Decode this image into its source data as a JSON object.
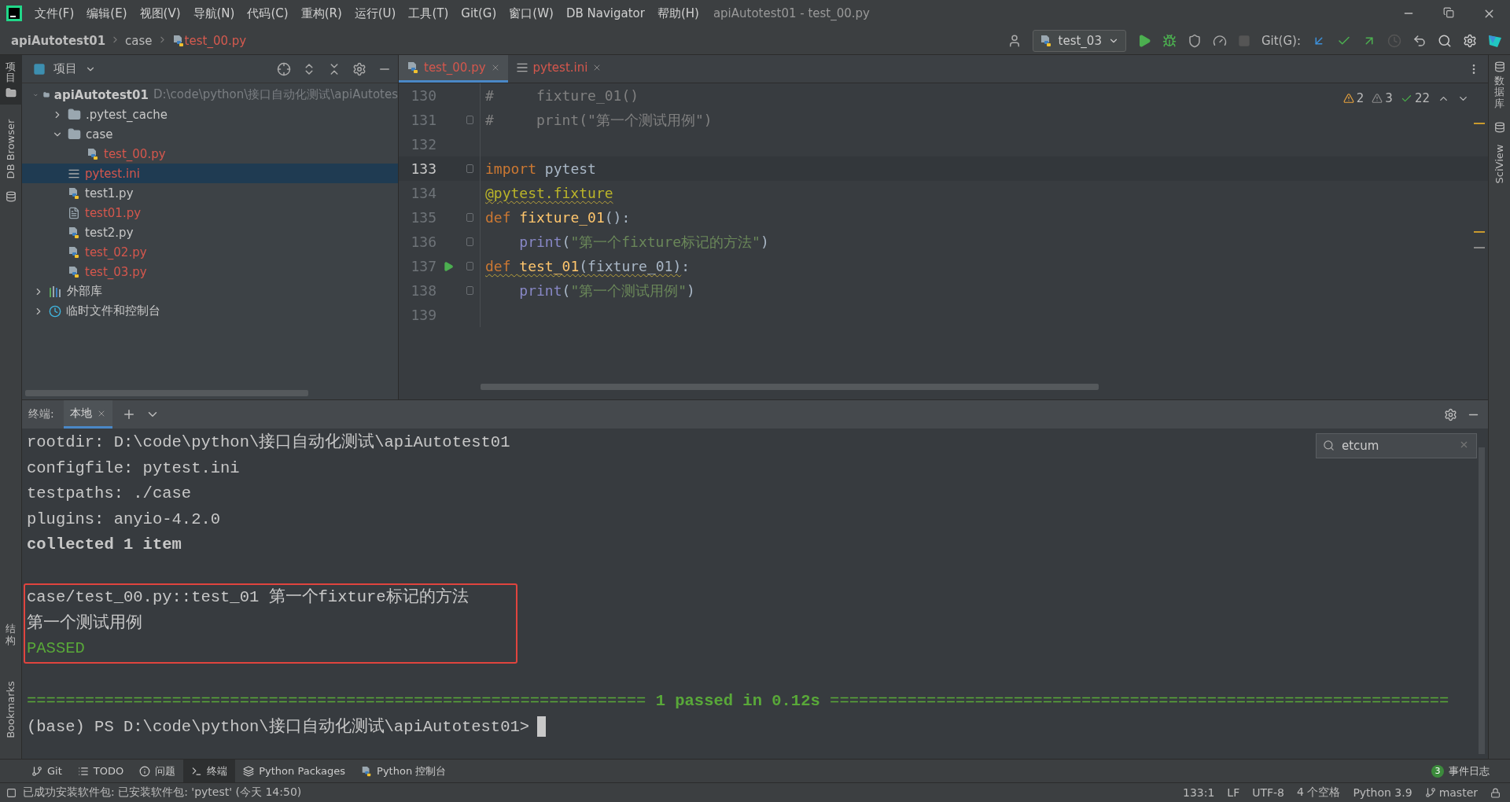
{
  "window_title": "apiAutotest01 - test_00.py",
  "menu": [
    "文件(F)",
    "编辑(E)",
    "视图(V)",
    "导航(N)",
    "代码(C)",
    "重构(R)",
    "运行(U)",
    "工具(T)",
    "Git(G)",
    "窗口(W)",
    "DB Navigator",
    "帮助(H)"
  ],
  "breadcrumb": [
    {
      "label": "apiAutotest01",
      "kind": "project"
    },
    {
      "label": "case",
      "kind": "folder"
    },
    {
      "label": "test_00.py",
      "kind": "file"
    }
  ],
  "toolbar": {
    "run_config": "test_03",
    "git_label": "Git(G):"
  },
  "left_stripe": [
    {
      "label": "项目",
      "kind": "cjk",
      "selected": true
    },
    {
      "label": "DB Browser",
      "kind": "latin",
      "selected": false
    }
  ],
  "left_stripe_bottom": [
    {
      "label": "结构",
      "kind": "cjk"
    },
    {
      "label": "Bookmarks",
      "kind": "latin"
    }
  ],
  "right_stripe": [
    {
      "label": "数据库",
      "kind": "cjk"
    },
    {
      "label": "SciView",
      "kind": "latin"
    }
  ],
  "project": {
    "title": "项目",
    "tree": [
      {
        "label": "apiAutotest01",
        "kind": "folder",
        "bold": true,
        "path": "D:\\code\\python\\接口自动化测试\\apiAutotes",
        "expanded": true,
        "selected": false,
        "untracked": false,
        "children": [
          {
            "label": ".pytest_cache",
            "kind": "folder",
            "expanded": false,
            "selected": false,
            "untracked": false
          },
          {
            "label": "case",
            "kind": "folder",
            "expanded": true,
            "selected": false,
            "untracked": false,
            "children": [
              {
                "label": "test_00.py",
                "kind": "python",
                "selected": false,
                "untracked": true
              }
            ]
          },
          {
            "label": "pytest.ini",
            "kind": "ini",
            "selected": true,
            "untracked": true
          },
          {
            "label": "test1.py",
            "kind": "python",
            "selected": false,
            "untracked": false
          },
          {
            "label": "test01.py",
            "kind": "text",
            "selected": false,
            "untracked": true
          },
          {
            "label": "test2.py",
            "kind": "python",
            "selected": false,
            "untracked": false
          },
          {
            "label": "test_02.py",
            "kind": "python",
            "selected": false,
            "untracked": true
          },
          {
            "label": "test_03.py",
            "kind": "python",
            "selected": false,
            "untracked": true
          }
        ]
      },
      {
        "label": "外部库",
        "kind": "library",
        "expanded": false,
        "selected": false,
        "untracked": false
      },
      {
        "label": "临时文件和控制台",
        "kind": "scratch",
        "expanded": false,
        "selected": false,
        "untracked": false
      }
    ]
  },
  "editor_tabs": [
    {
      "label": "test_00.py",
      "kind": "python",
      "selected": true
    },
    {
      "label": "pytest.ini",
      "kind": "ini",
      "selected": false
    }
  ],
  "inspections": [
    {
      "count": "2",
      "kind": "warning"
    },
    {
      "count": "3",
      "kind": "weak"
    },
    {
      "count": "22",
      "kind": "typo"
    }
  ],
  "code_lines": [
    {
      "number": "130",
      "current": false,
      "fold": false,
      "run": false,
      "tokens": [
        {
          "text": "#     fixture_01()",
          "kind": "comment"
        }
      ]
    },
    {
      "number": "131",
      "current": false,
      "fold": true,
      "run": false,
      "tokens": [
        {
          "text": "#     print(\"第一个测试用例\")",
          "kind": "comment"
        }
      ]
    },
    {
      "number": "132",
      "current": false,
      "fold": false,
      "run": false
    },
    {
      "number": "133",
      "current": true,
      "fold": true,
      "run": false,
      "tokens": [
        {
          "text": "import",
          "kind": "keyword"
        },
        {
          "text": " pytest",
          "kind": "plain"
        }
      ]
    },
    {
      "number": "134",
      "current": false,
      "fold": false,
      "run": false,
      "tokens": [
        {
          "text": "@pytest.fixture",
          "kind": "decorator",
          "warned": true
        }
      ]
    },
    {
      "number": "135",
      "current": false,
      "fold": true,
      "run": false,
      "tokens": [
        {
          "text": "def ",
          "kind": "keyword"
        },
        {
          "text": "fixture_01",
          "kind": "function"
        },
        {
          "text": "():",
          "kind": "plain"
        }
      ]
    },
    {
      "number": "136",
      "current": false,
      "fold": true,
      "run": false,
      "tokens": [
        {
          "text": "    print",
          "kind": "builtin"
        },
        {
          "text": "(",
          "kind": "plain"
        },
        {
          "text": "\"第一个fixture标记的方法\"",
          "kind": "string"
        },
        {
          "text": ")",
          "kind": "plain"
        }
      ]
    },
    {
      "number": "137",
      "current": false,
      "fold": true,
      "run": true,
      "tokens": [
        {
          "text": "def ",
          "kind": "keyword",
          "warned": true
        },
        {
          "text": "test_01",
          "kind": "function",
          "warned": true
        },
        {
          "text": "(fixture_01)",
          "kind": "plain",
          "warned": true
        },
        {
          "text": ":",
          "kind": "plain"
        }
      ]
    },
    {
      "number": "138",
      "current": false,
      "fold": true,
      "run": false,
      "tokens": [
        {
          "text": "    print",
          "kind": "builtin"
        },
        {
          "text": "(",
          "kind": "plain"
        },
        {
          "text": "\"第一个测试用例\"",
          "kind": "string"
        },
        {
          "text": ")",
          "kind": "plain"
        }
      ]
    },
    {
      "number": "139",
      "current": false,
      "fold": false,
      "run": false
    }
  ],
  "terminal": {
    "title": "终端:",
    "tabs": [
      {
        "label": "本地",
        "selected": true
      }
    ],
    "search": {
      "value": "etcum"
    },
    "lines": [
      {
        "text": "rootdir: D:\\code\\python\\接口自动化测试\\apiAutotest01",
        "kind": "normal",
        "highlighted": false
      },
      {
        "text": "configfile: pytest.ini",
        "kind": "normal",
        "highlighted": false
      },
      {
        "text": "testpaths: ./case",
        "kind": "normal",
        "highlighted": false
      },
      {
        "text": "plugins: anyio-4.2.0",
        "kind": "normal",
        "highlighted": false
      },
      {
        "text": "collected 1 item",
        "kind": "bold",
        "highlighted": false
      },
      {
        "kind": "blank"
      },
      {
        "text": "case/test_00.py::test_01 第一个fixture标记的方法",
        "kind": "normal",
        "highlighted": true
      },
      {
        "text": "第一个测试用例",
        "kind": "normal",
        "highlighted": true
      },
      {
        "text": "PASSED",
        "kind": "passed",
        "highlighted": true
      },
      {
        "kind": "blank"
      },
      {
        "text": "================================================================ **1 passed in 0.12s** ================================================================",
        "kind": "summary",
        "highlighted": false
      },
      {
        "text": "(base) PS D:\\code\\python\\接口自动化测试\\apiAutotest01>",
        "kind": "prompt",
        "highlighted": false
      }
    ]
  },
  "tool_tabs": [
    {
      "label": "Git",
      "kind": "git",
      "selected": false
    },
    {
      "label": "TODO",
      "kind": "todo",
      "selected": false
    },
    {
      "label": "问题",
      "kind": "problems",
      "selected": false
    },
    {
      "label": "终端",
      "kind": "terminal",
      "selected": true
    },
    {
      "label": "Python Packages",
      "kind": "packages",
      "selected": false
    },
    {
      "label": "Python 控制台",
      "kind": "console",
      "selected": false
    }
  ],
  "event_log": {
    "count": "3",
    "label": "事件日志"
  },
  "status": {
    "message": "已成功安装软件包: 已安装软件包: 'pytest' (今天 14:50)",
    "items": [
      "133:1",
      "LF",
      "UTF-8",
      "4 个空格",
      "Python 3.9"
    ],
    "branch": "master"
  }
}
